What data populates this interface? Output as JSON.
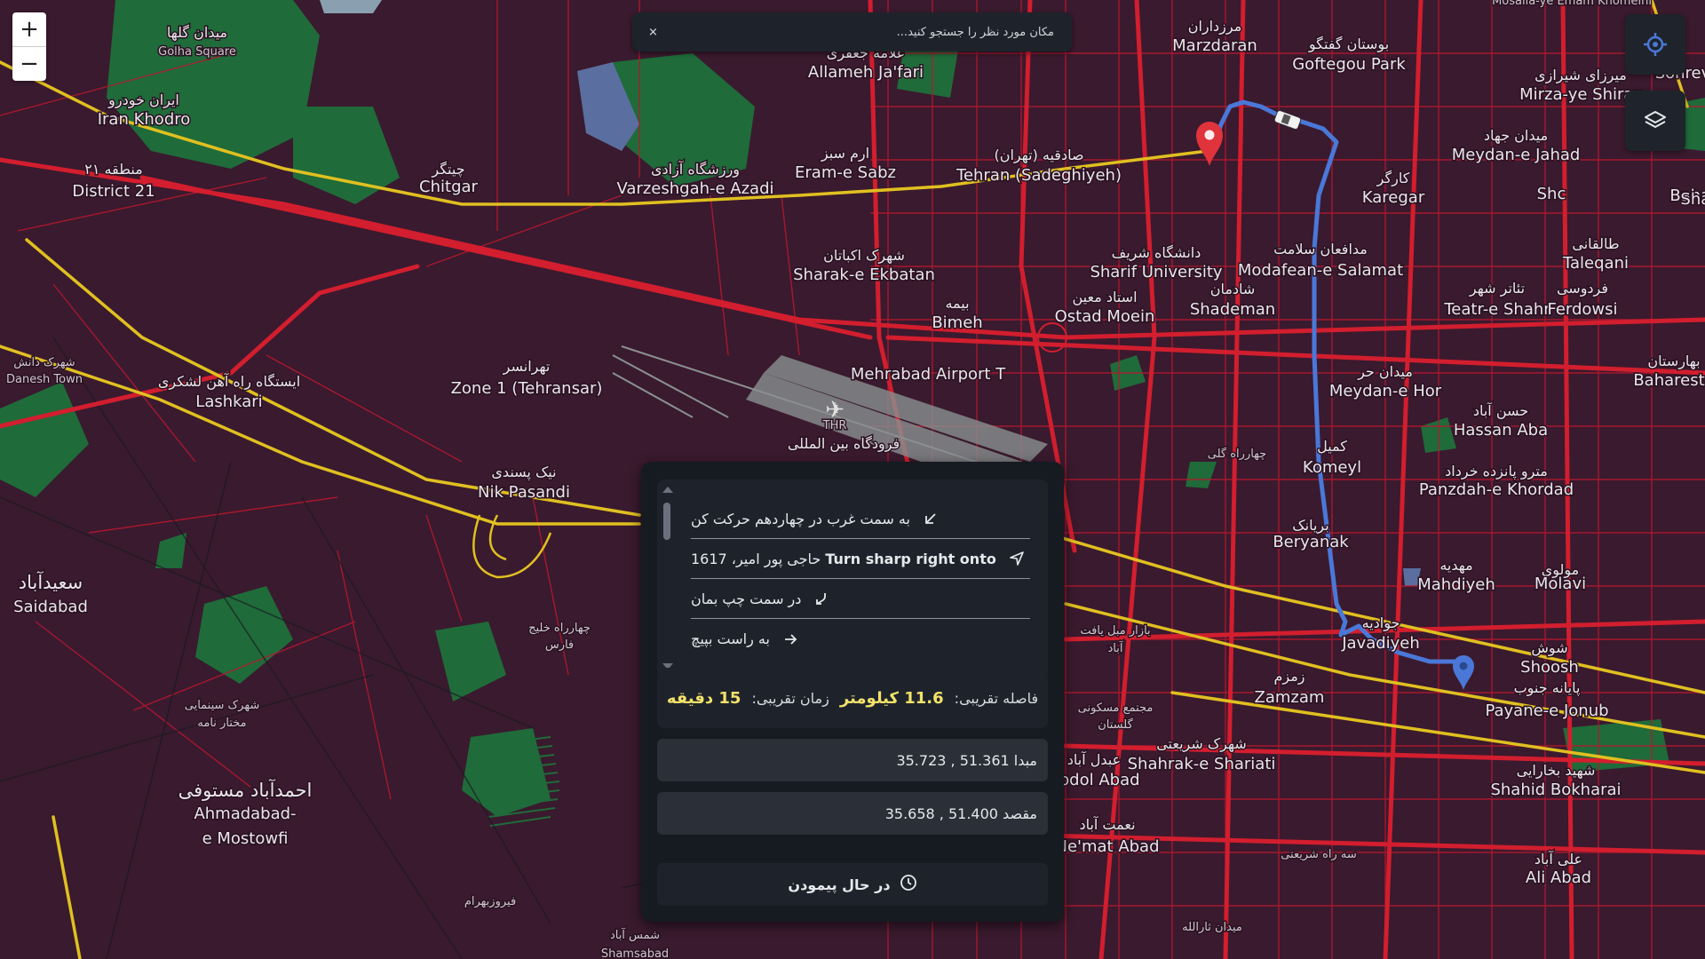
{
  "search": {
    "placeholder": "مکان مورد نظر را جستجو کنید...",
    "clear_label": "×"
  },
  "zoom": {
    "in_label": "+",
    "out_label": "−"
  },
  "controls": {
    "locate_icon": "crosshair-icon",
    "layers_icon": "layers-icon"
  },
  "colors": {
    "map_bg": "#3a1a2e",
    "road_major": "#d21e2e",
    "road_minor": "#c81c36",
    "highway": "#e0c020",
    "park": "#1f6b3a",
    "route": "#4a78d8",
    "accent": "#f3e26a",
    "marker_start": "#e0333b",
    "marker_end": "#4a78d8"
  },
  "map_labels": [
    {
      "text": "میدان گلها",
      "cls": "fa"
    },
    {
      "text": "Golha Square",
      "cls": "en-s"
    },
    {
      "text": "ایران خودرو",
      "cls": "fa"
    },
    {
      "text": "Iran Khodro",
      "cls": "en"
    },
    {
      "text": "منطقه ۲۱",
      "cls": "fa"
    },
    {
      "text": "District 21",
      "cls": "en"
    },
    {
      "text": "چیتگر",
      "cls": "fa"
    },
    {
      "text": "Chitgar",
      "cls": "en"
    },
    {
      "text": "ورزشگاه آزادی",
      "cls": "fa"
    },
    {
      "text": "Varzeshgah-e Azadi",
      "cls": "en"
    },
    {
      "text": "علامه جعفری",
      "cls": "fa"
    },
    {
      "text": "Allameh Ja'fari",
      "cls": "en"
    },
    {
      "text": "ارم سبز",
      "cls": "fa"
    },
    {
      "text": "Eram-e Sabz",
      "cls": "en"
    },
    {
      "text": "صادقیه (تهران)",
      "cls": "fa"
    },
    {
      "text": "Tehran (Sadeghiyeh)",
      "cls": "en"
    },
    {
      "text": "مرزداران",
      "cls": "fa"
    },
    {
      "text": "Marzdaran",
      "cls": "en"
    },
    {
      "text": "بوستان گفتگو",
      "cls": "fa"
    },
    {
      "text": "Goftegou Park",
      "cls": "en"
    },
    {
      "text": "میرزای شیرازی",
      "cls": "fa"
    },
    {
      "text": "Mirza-ye Shiraz",
      "cls": "en"
    },
    {
      "text": "میدان جهاد",
      "cls": "fa"
    },
    {
      "text": "Meydan-e Jahad",
      "cls": "en"
    },
    {
      "text": "کارگر",
      "cls": "fa"
    },
    {
      "text": "Karegar",
      "cls": "en"
    },
    {
      "text": "دانشگاه شریف",
      "cls": "fa"
    },
    {
      "text": "Sharif University",
      "cls": "en"
    },
    {
      "text": "مدافعان سلامت",
      "cls": "fa"
    },
    {
      "text": "Modafean-e Salamat",
      "cls": "en"
    },
    {
      "text": "شهرک اکباتان",
      "cls": "fa"
    },
    {
      "text": "Sharak-e Ekbatan",
      "cls": "en"
    },
    {
      "text": "بیمه",
      "cls": "fa"
    },
    {
      "text": "Bimeh",
      "cls": "en"
    },
    {
      "text": "استاد معین",
      "cls": "fa"
    },
    {
      "text": "Ostad Moein",
      "cls": "en"
    },
    {
      "text": "شادمان",
      "cls": "fa"
    },
    {
      "text": "Shademan",
      "cls": "en"
    },
    {
      "text": "تئاتر شهر",
      "cls": "fa"
    },
    {
      "text": "Teatr-e Shahr",
      "cls": "en"
    },
    {
      "text": "فردوسی",
      "cls": "fa"
    },
    {
      "text": "Ferdowsi",
      "cls": "en"
    },
    {
      "text": "طالقانی",
      "cls": "fa"
    },
    {
      "text": "Taleqani",
      "cls": "en"
    },
    {
      "text": "تهرانسر",
      "cls": "fa"
    },
    {
      "text": "Zone 1 (Tehransar)",
      "cls": "en"
    },
    {
      "text": "Mehrabad Airport T",
      "cls": "en"
    },
    {
      "text": "THR",
      "cls": "en-s"
    },
    {
      "text": "فرودگاه بین المللی",
      "cls": "fa"
    },
    {
      "text": "میدان حر",
      "cls": "fa"
    },
    {
      "text": "Meydan-e Hor",
      "cls": "en"
    },
    {
      "text": "حسن آباد",
      "cls": "fa"
    },
    {
      "text": "Hassan Aba",
      "cls": "en"
    },
    {
      "text": "بهارستان",
      "cls": "fa"
    },
    {
      "text": "Baharesta",
      "cls": "en"
    },
    {
      "text": "شهرک دانش",
      "cls": "fa-s"
    },
    {
      "text": "Danesh Town",
      "cls": "en-s"
    },
    {
      "text": "ایستگاه راه آهن لشکری",
      "cls": "fa"
    },
    {
      "text": "Lashkari",
      "cls": "en"
    },
    {
      "text": "نیک پسندی",
      "cls": "fa"
    },
    {
      "text": "Nik Pasandi",
      "cls": "en"
    },
    {
      "text": "کمیل",
      "cls": "fa"
    },
    {
      "text": "Komeyl",
      "cls": "en"
    },
    {
      "text": "مترو پانزده خرداد",
      "cls": "fa"
    },
    {
      "text": "Panzdah-e Khordad",
      "cls": "en"
    },
    {
      "text": "بریانک",
      "cls": "fa"
    },
    {
      "text": "Beryanak",
      "cls": "en"
    },
    {
      "text": "مولوی",
      "cls": "fa"
    },
    {
      "text": "Molavi",
      "cls": "en"
    },
    {
      "text": "مهدیه",
      "cls": "fa"
    },
    {
      "text": "Mahdiyeh",
      "cls": "en"
    },
    {
      "text": "سعیدآباد",
      "cls": "fa-b"
    },
    {
      "text": "Saidabad",
      "cls": "en"
    },
    {
      "text": "جوادیه",
      "cls": "fa"
    },
    {
      "text": "Javadiyeh",
      "cls": "en"
    },
    {
      "text": "شوش",
      "cls": "fa"
    },
    {
      "text": "Shoosh",
      "cls": "en"
    },
    {
      "text": "زمزم",
      "cls": "fa"
    },
    {
      "text": "Zamzam",
      "cls": "en"
    },
    {
      "text": "پایانه جنوب",
      "cls": "fa"
    },
    {
      "text": "Payane-e Jonub",
      "cls": "en"
    },
    {
      "text": "شهرک شریعتی",
      "cls": "fa"
    },
    {
      "text": "Shahrak-e Shariati",
      "cls": "en"
    },
    {
      "text": "شهید بخارایی",
      "cls": "fa"
    },
    {
      "text": "Shahid Bokharai",
      "cls": "en"
    },
    {
      "text": "عبدل آباد",
      "cls": "fa"
    },
    {
      "text": "Abdol Abad",
      "cls": "en"
    },
    {
      "text": "نعمت آباد",
      "cls": "fa"
    },
    {
      "text": "Ne'mat Abad",
      "cls": "en"
    },
    {
      "text": "علی آباد",
      "cls": "fa"
    },
    {
      "text": "Ali Abad",
      "cls": "en"
    },
    {
      "text": "احمدآباد مستوفی",
      "cls": "fa-b"
    },
    {
      "text": "Ahmadabad-",
      "cls": "en"
    },
    {
      "text": "e Mostowfi",
      "cls": "en"
    },
    {
      "text": "شهرک سینمایی",
      "cls": "fa-s"
    },
    {
      "text": "مختار نامه",
      "cls": "fa-s"
    },
    {
      "text": "چهارراه خلیج",
      "cls": "fa-s"
    },
    {
      "text": "فارس",
      "cls": "fa-s"
    },
    {
      "text": "بازار مبل یافت",
      "cls": "fa-s"
    },
    {
      "text": "آباد",
      "cls": "fa-s"
    },
    {
      "text": "مجتمع مسکونی",
      "cls": "fa-s"
    },
    {
      "text": "گلستان",
      "cls": "fa-s"
    },
    {
      "text": "چهارراه گلی",
      "cls": "fa-s"
    },
    {
      "text": "سه راه شریعتی",
      "cls": "fa-s"
    },
    {
      "text": "فیروزبهرام",
      "cls": "fa-s"
    },
    {
      "text": "شمس آباد",
      "cls": "fa-s"
    },
    {
      "text": "Shamsabad",
      "cls": "en-s"
    },
    {
      "text": "میدان ثارالله",
      "cls": "fa-s"
    },
    {
      "text": "Mosalla-ye Emam Khomeini",
      "cls": "en-s"
    },
    {
      "text": "Sohrev",
      "cls": "en"
    },
    {
      "text": "Shc",
      "cls": "en"
    },
    {
      "text": "Bahar",
      "cls": "en"
    },
    {
      "text": "Shahid Sepahb",
      "cls": "en"
    }
  ],
  "directions": {
    "steps": [
      {
        "icon": "arrow-down-left-icon",
        "text": "به سمت غرب در چهاردهم حرکت کن",
        "bold": ""
      },
      {
        "icon": "navigation-icon",
        "text": "حاجی پور امیر، 1617",
        "bold": "Turn sharp right onto"
      },
      {
        "icon": "arrow-bend-icon",
        "text": "در سمت چپ بمان",
        "bold": ""
      },
      {
        "icon": "arrow-right-icon",
        "text": "به راست بپیچ",
        "bold": ""
      }
    ],
    "distance_label": "فاصله تقریبی:",
    "distance_value": "11.6 کیلومتر",
    "time_label": "زمان تقریبی:",
    "time_value": "15 دقیقه",
    "origin": "مبدا 51.361 , 35.723",
    "destination": "مقصد 51.400 , 35.658",
    "status_button": "در حال پیمودن"
  }
}
